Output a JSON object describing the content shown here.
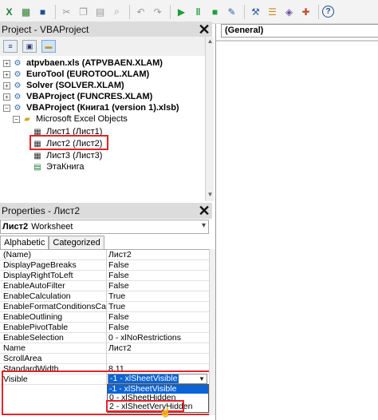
{
  "toolbar": {
    "icons": [
      "excel-icon",
      "insert-icon",
      "save-icon",
      "cut-icon",
      "copy-icon",
      "paste-icon",
      "find-icon",
      "undo-icon",
      "redo-icon",
      "run-icon",
      "break-icon",
      "reset-icon",
      "design-mode-icon",
      "project-explorer-icon",
      "properties-icon",
      "object-browser-icon",
      "toolbox-icon",
      "help-icon"
    ]
  },
  "project_panel": {
    "title": "Project - VBAProject",
    "tree": [
      {
        "label": "atpvbaen.xls (ATPVBAEN.XLAM)",
        "bold": true,
        "level": 0
      },
      {
        "label": "EuroTool (EUROTOOL.XLAM)",
        "bold": true,
        "level": 0
      },
      {
        "label": "Solver (SOLVER.XLAM)",
        "bold": true,
        "level": 0
      },
      {
        "label": "VBAProject (FUNCRES.XLAM)",
        "bold": true,
        "level": 0
      },
      {
        "label": "VBAProject (Книга1 (version 1).xlsb)",
        "bold": true,
        "level": 0
      },
      {
        "label": "Microsoft Excel Objects",
        "bold": false,
        "level": 1
      },
      {
        "label": "Лист1 (Лист1)",
        "bold": false,
        "level": 2
      },
      {
        "label": "Лист2 (Лист2)",
        "bold": false,
        "level": 2
      },
      {
        "label": "Лист3 (Лист3)",
        "bold": false,
        "level": 2
      },
      {
        "label": "ЭтаКнига",
        "bold": false,
        "level": 2
      }
    ]
  },
  "properties_panel": {
    "title": "Properties - Лист2",
    "object_combo": {
      "name": "Лист2",
      "type": "Worksheet"
    },
    "tabs": [
      "Alphabetic",
      "Categorized"
    ],
    "rows": [
      {
        "name": "(Name)",
        "value": "Лист2"
      },
      {
        "name": "DisplayPageBreaks",
        "value": "False"
      },
      {
        "name": "DisplayRightToLeft",
        "value": "False"
      },
      {
        "name": "EnableAutoFilter",
        "value": "False"
      },
      {
        "name": "EnableCalculation",
        "value": "True"
      },
      {
        "name": "EnableFormatConditionsCalculation",
        "value": "True"
      },
      {
        "name": "EnableOutlining",
        "value": "False"
      },
      {
        "name": "EnablePivotTable",
        "value": "False"
      },
      {
        "name": "EnableSelection",
        "value": "0 - xlNoRestrictions"
      },
      {
        "name": "Name",
        "value": "Лист2"
      },
      {
        "name": "ScrollArea",
        "value": ""
      },
      {
        "name": "StandardWidth",
        "value": "8,11"
      },
      {
        "name": "Visible",
        "value": "-1 - xlSheetVisible"
      }
    ],
    "visible_dropdown": {
      "current": "-1 - xlSheetVisible",
      "options": [
        "-1 - xlSheetVisible",
        "0 - xlSheetHidden",
        "2 - xlSheetVeryHidden"
      ]
    }
  },
  "code_window": {
    "object_combo": "(General)"
  },
  "colors": {
    "highlight_red": "#e0252b",
    "selection_blue": "#0a64d6"
  }
}
